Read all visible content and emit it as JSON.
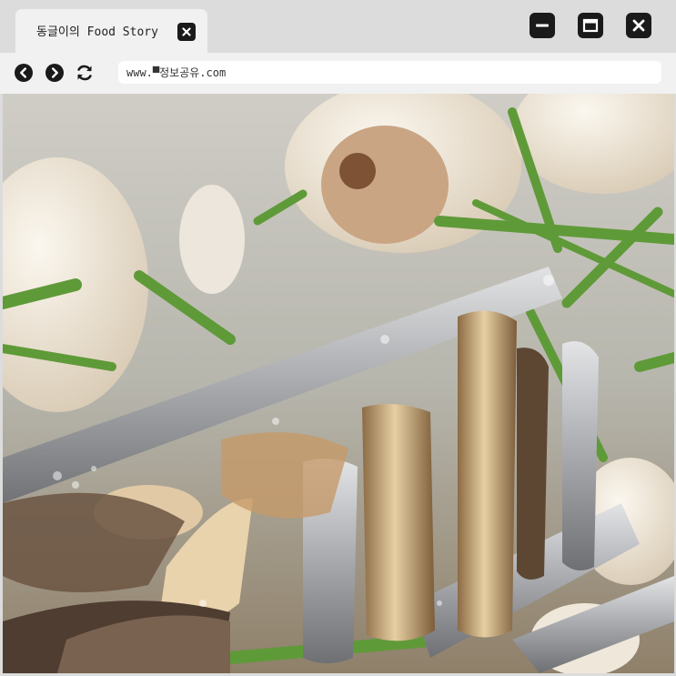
{
  "tab": {
    "title": "동글이의 Food Story"
  },
  "address_bar": {
    "url": "www.▀정보공유.com"
  },
  "icons": {
    "tab_close": "close-icon",
    "minimize": "minimize-icon",
    "maximize": "maximize-icon",
    "close": "close-icon",
    "back": "back-arrow-icon",
    "forward": "forward-arrow-icon",
    "reload": "reload-icon"
  },
  "colors": {
    "chrome_bg": "#dcdcdc",
    "tab_bg": "#f1f1f1",
    "button_dark": "#1a1a1a"
  }
}
